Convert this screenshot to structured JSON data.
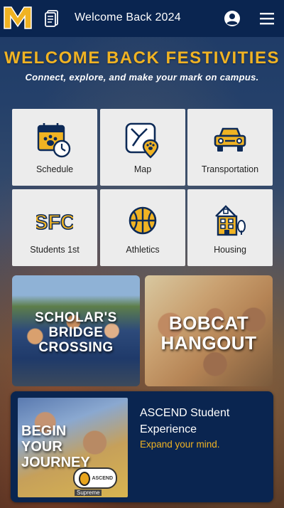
{
  "header": {
    "title": "Welcome Back 2024",
    "logo_icon": "university-m-logo",
    "left_icon": "directory-icon",
    "profile_icon": "user-circle-icon",
    "menu_icon": "hamburger-menu-icon",
    "bar_color": "#0a2550"
  },
  "hero": {
    "title": "WELCOME BACK FESTIVITIES",
    "subtitle": "Connect, explore, and make your mark on campus.",
    "title_color": "#f0b323"
  },
  "tiles": [
    {
      "label": "Schedule",
      "icon": "calendar-clock-icon"
    },
    {
      "label": "Map",
      "icon": "map-pin-icon"
    },
    {
      "label": "Transportation",
      "icon": "car-icon"
    },
    {
      "label": "Students 1st",
      "icon": "sfc-text-icon",
      "icon_text": "SFC"
    },
    {
      "label": "Athletics",
      "icon": "basketball-icon"
    },
    {
      "label": "Housing",
      "icon": "building-icon"
    }
  ],
  "cards": {
    "scholar": {
      "lines": [
        "SCHOLAR'S",
        "BRIDGE",
        "CROSSING"
      ]
    },
    "bobcat": {
      "lines": [
        "BOBCAT",
        "HANGOUT"
      ]
    }
  },
  "ascend": {
    "image_lines": [
      "BEGIN",
      "YOUR",
      "JOURNEY"
    ],
    "badge_text": "ASCEND",
    "badge_footer": "Supreme",
    "title": "ASCEND Student Experience",
    "subtitle": "Expand your mind."
  },
  "colors": {
    "navy": "#0a2550",
    "gold": "#f0b323",
    "tile_bg": "#ececec",
    "icon_navy": "#0d2a57"
  }
}
